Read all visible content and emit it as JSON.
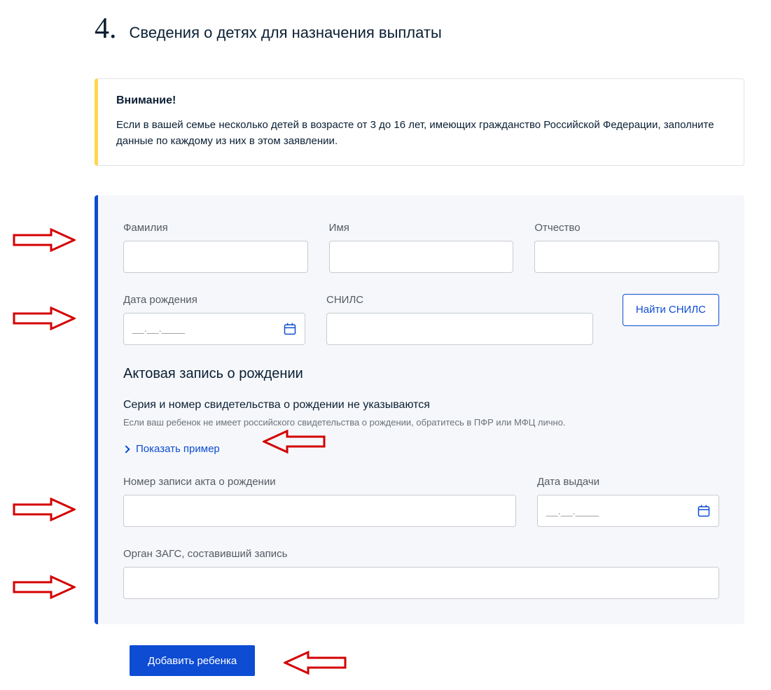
{
  "section": {
    "number": "4.",
    "title": "Сведения о детях для назначения выплаты"
  },
  "warning": {
    "title": "Внимание!",
    "text": "Если в вашей семье несколько детей в возрасте от 3 до 16 лет, имеющих гражданство Российской Федерации, заполните данные по каждому из них в этом заявлении."
  },
  "fields": {
    "surname": {
      "label": "Фамилия",
      "value": ""
    },
    "name": {
      "label": "Имя",
      "value": ""
    },
    "patronymic": {
      "label": "Отчество",
      "value": ""
    },
    "birthdate": {
      "label": "Дата рождения",
      "placeholder": "__.__.____"
    },
    "snils": {
      "label": "СНИЛС",
      "value": ""
    },
    "findSnilsBtn": "Найти СНИЛС"
  },
  "birthRecord": {
    "heading": "Актовая запись о рождении",
    "line1": "Серия и номер свидетельства о рождении не указываются",
    "line2": "Если ваш ребенок не имеет российского свидетельства о рождении, обратитесь в ПФР или МФЦ лично.",
    "exampleLink": "Показать пример",
    "recordNumber": {
      "label": "Номер записи акта о рождении",
      "value": ""
    },
    "issueDate": {
      "label": "Дата выдачи",
      "placeholder": "__.__.____"
    },
    "zagsOrgan": {
      "label": "Орган ЗАГС, составивший запись",
      "value": ""
    }
  },
  "addChildBtn": "Добавить ребенка"
}
